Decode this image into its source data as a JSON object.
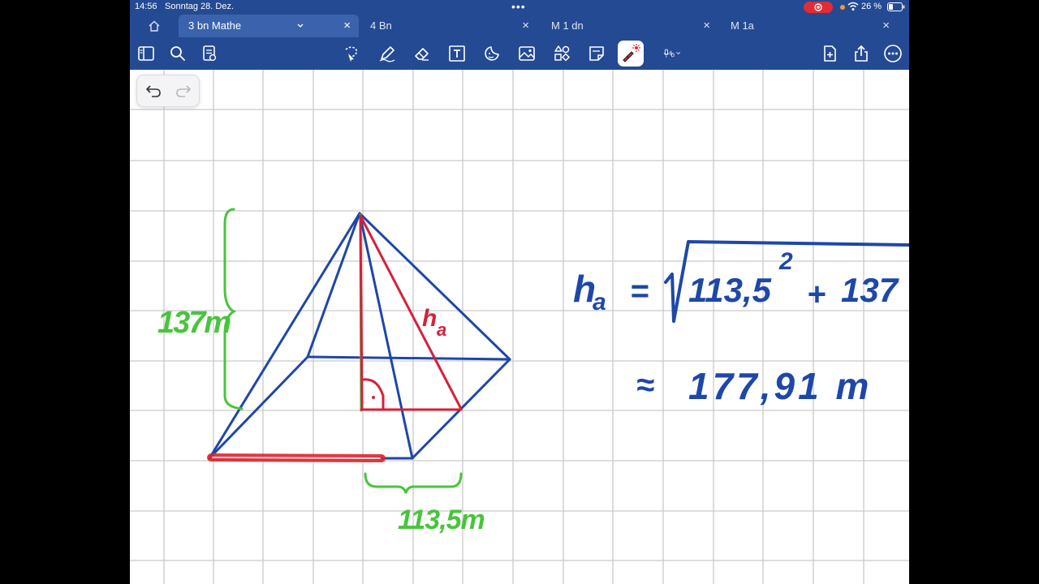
{
  "status": {
    "time": "14:56",
    "date": "Sonntag 28. Dez.",
    "battery": "26 %"
  },
  "tabs": [
    {
      "label": "3 bn Mathe",
      "active": true
    },
    {
      "label": "4 Bn",
      "active": false
    },
    {
      "label": "M 1 dn",
      "active": false
    },
    {
      "label": "M 1a",
      "active": false
    }
  ],
  "icons": {
    "toolbar_left": [
      "sidebar-icon",
      "search-icon",
      "page-list-icon"
    ],
    "toolbar_tools": [
      "lasso-icon",
      "pen-icon",
      "eraser-icon",
      "text-box-icon",
      "sticker-icon",
      "image-icon",
      "shapes-icon",
      "sticky-note-icon",
      "laser-pointer-icon",
      "mic-icon"
    ],
    "toolbar_right": [
      "add-page-icon",
      "share-icon",
      "more-icon"
    ],
    "undo": "undo-icon",
    "redo": "redo-icon"
  },
  "colors": {
    "chrome": "#244a93",
    "active_tab": "#3b63ad",
    "ink_blue": "#1e47a8",
    "ink_red": "#d5213a",
    "ink_green": "#49c43d",
    "grid": "#c9c9cc",
    "record": "#e32b36"
  },
  "drawing": {
    "height_label": "137m",
    "base_half_label": "113,5m",
    "slant_height_label": "h",
    "slant_height_subscript": "a",
    "right_angle_mark": "·",
    "formula": {
      "lhs": "h",
      "lhs_subscript": "a",
      "equals": "=",
      "radicand_first": "113,5",
      "exponent": "2",
      "plus": "+",
      "radicand_second": "137",
      "approx": "≈",
      "result": "177,91 m"
    }
  }
}
